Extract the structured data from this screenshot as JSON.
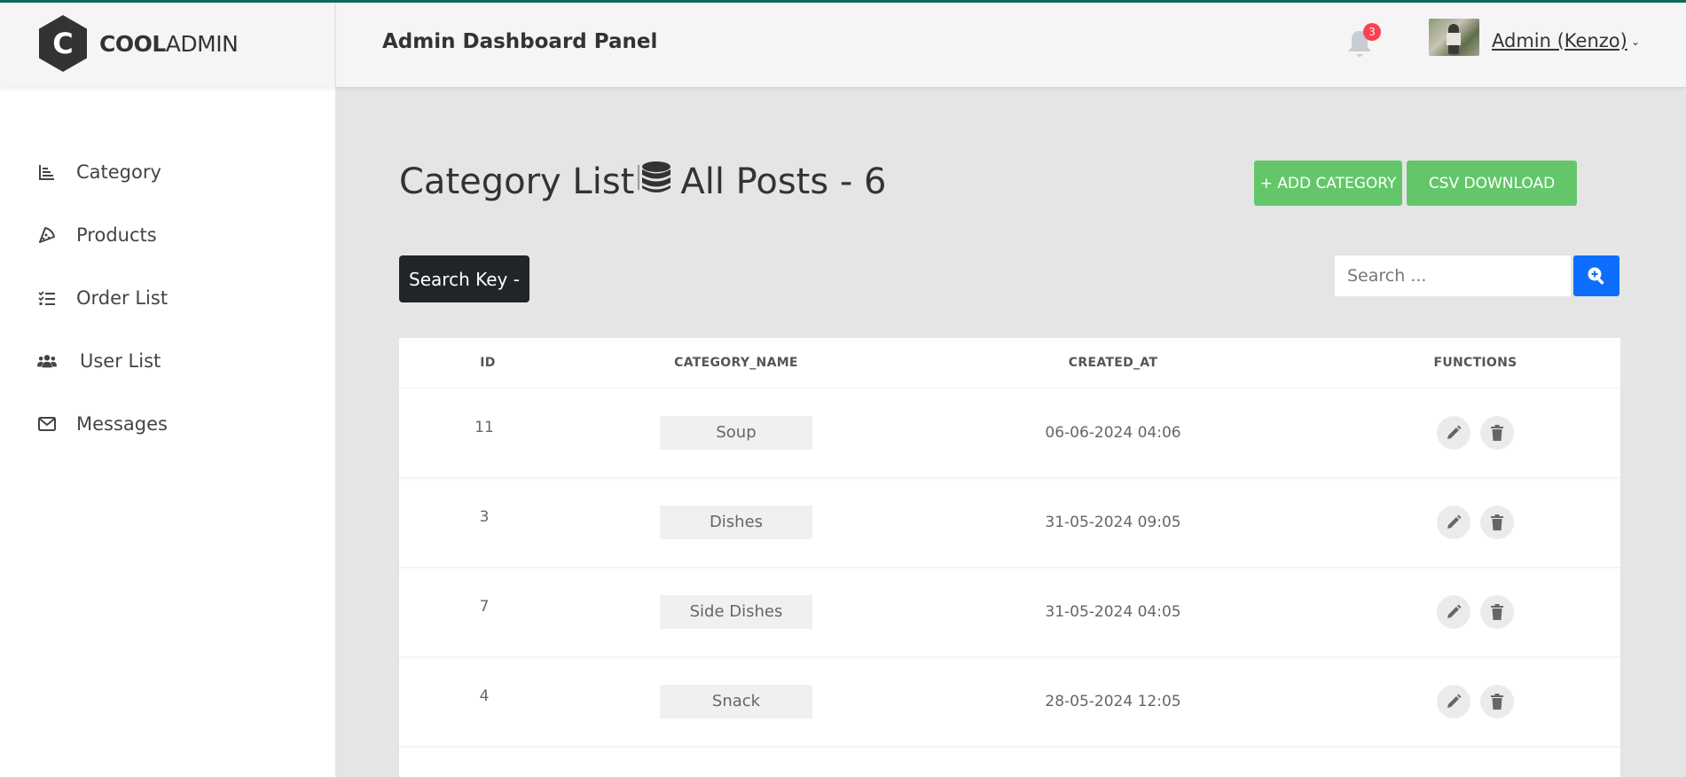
{
  "brand": {
    "bold": "COOL",
    "normal": "ADMIN",
    "letter": "C"
  },
  "header": {
    "title": "Admin Dashboard Panel",
    "notification_count": "3",
    "user_name": "Admin (Kenzo)"
  },
  "sidebar": {
    "items": [
      {
        "label": "Category",
        "icon": "chart-bar-icon"
      },
      {
        "label": "Products",
        "icon": "pizza-slice-icon"
      },
      {
        "label": "Order List",
        "icon": "list-check-icon"
      },
      {
        "label": "User List",
        "icon": "users-icon"
      },
      {
        "label": "Messages",
        "icon": "envelope-icon"
      }
    ]
  },
  "page": {
    "title_left": "Category List",
    "title_right": "All Posts - 6",
    "add_button": "+ ADD CATEGORY",
    "csv_button": "CSV DOWNLOAD",
    "search_key_label": "Search Key -",
    "search_placeholder": "Search ..."
  },
  "table": {
    "columns": [
      "ID",
      "CATEGORY_NAME",
      "CREATED_AT",
      "FUNCTIONS"
    ],
    "rows": [
      {
        "id": "11",
        "name": "Soup",
        "created_at": "06-06-2024 04:06"
      },
      {
        "id": "3",
        "name": "Dishes",
        "created_at": "31-05-2024 09:05"
      },
      {
        "id": "7",
        "name": "Side Dishes",
        "created_at": "31-05-2024 04:05"
      },
      {
        "id": "4",
        "name": "Snack",
        "created_at": "28-05-2024 12:05"
      }
    ]
  },
  "colors": {
    "accent_green": "#63c76a",
    "search_blue": "#0d6efd",
    "badge_red": "#fa4251",
    "dark": "#212529"
  }
}
